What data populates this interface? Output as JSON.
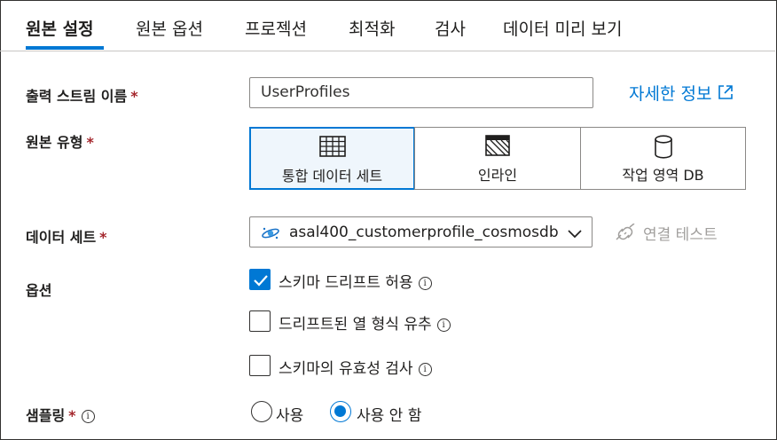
{
  "tabs": [
    {
      "label": "원본 설정",
      "active": true
    },
    {
      "label": "원본 옵션"
    },
    {
      "label": "프로젝션"
    },
    {
      "label": "최적화"
    },
    {
      "label": "검사"
    },
    {
      "label": "데이터 미리 보기"
    }
  ],
  "form": {
    "required_mark": "*",
    "output_stream": {
      "label": "출력 스트림 이름",
      "value": "UserProfiles"
    },
    "learn_more": "자세한 정보",
    "source_type": {
      "label": "원본 유형",
      "options": [
        {
          "label": "통합 데이터 세트",
          "icon": "table-grid-icon",
          "selected": true
        },
        {
          "label": "인라인",
          "icon": "inline-hatched-icon"
        },
        {
          "label": "작업 영역 DB",
          "icon": "database-cylinder-icon"
        }
      ]
    },
    "dataset": {
      "label": "데이터 세트",
      "value": "asal400_customerprofile_cosmosdb",
      "icon": "cosmos-db-icon"
    },
    "test_connection": "연결 테스트",
    "options": {
      "label": "옵션",
      "checkboxes": [
        {
          "label": "스키마 드리프트 허용",
          "checked": true
        },
        {
          "label": "드리프트된 열 형식 유추",
          "checked": false
        },
        {
          "label": "스키마의 유효성 검사",
          "checked": false
        }
      ]
    },
    "sampling": {
      "label": "샘플링",
      "options": [
        {
          "label": "사용",
          "selected": false
        },
        {
          "label": "사용 안 함",
          "selected": true
        }
      ]
    }
  },
  "colors": {
    "accent": "#0078d4",
    "required": "#a4262c",
    "disabled": "#a19f9d",
    "selected_bg": "#eff6fc"
  }
}
